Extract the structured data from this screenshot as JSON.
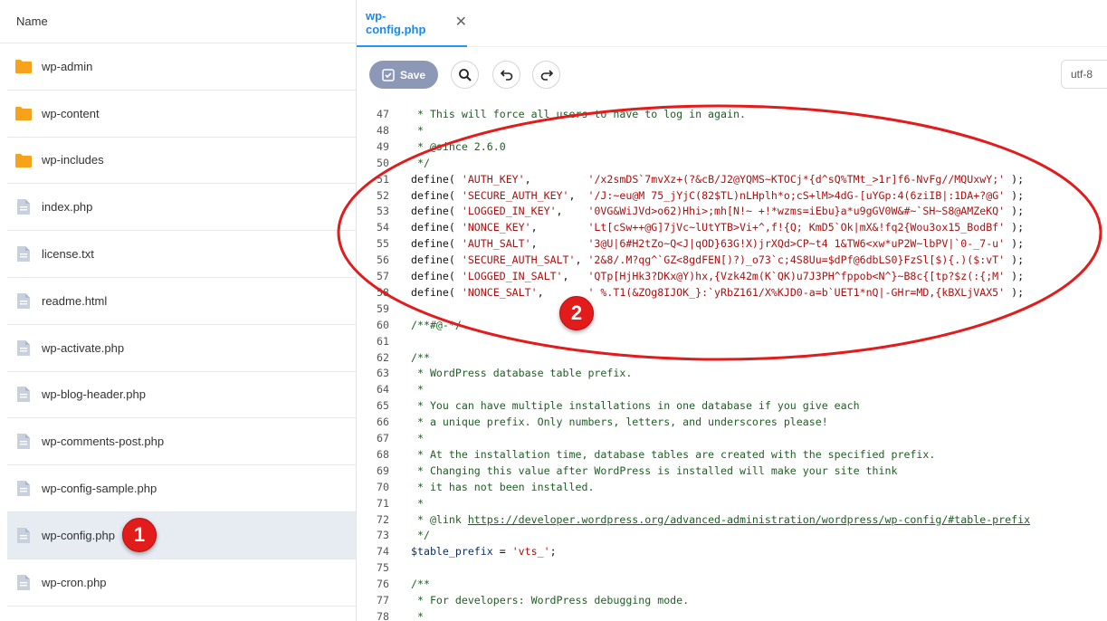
{
  "file_panel": {
    "header": "Name",
    "files": [
      {
        "name": "wp-admin",
        "type": "folder"
      },
      {
        "name": "wp-content",
        "type": "folder"
      },
      {
        "name": "wp-includes",
        "type": "folder"
      },
      {
        "name": "index.php",
        "type": "file"
      },
      {
        "name": "license.txt",
        "type": "file"
      },
      {
        "name": "readme.html",
        "type": "file"
      },
      {
        "name": "wp-activate.php",
        "type": "file"
      },
      {
        "name": "wp-blog-header.php",
        "type": "file"
      },
      {
        "name": "wp-comments-post.php",
        "type": "file"
      },
      {
        "name": "wp-config-sample.php",
        "type": "file"
      },
      {
        "name": "wp-config.php",
        "type": "file",
        "selected": true
      },
      {
        "name": "wp-cron.php",
        "type": "file"
      }
    ]
  },
  "editor": {
    "tab": {
      "label": "wp-config.php",
      "close_icon": "close-icon"
    },
    "toolbar": {
      "save_label": "Save",
      "search_icon": "search-icon",
      "undo_icon": "undo-icon",
      "redo_icon": "redo-icon",
      "encoding": "utf-8"
    },
    "code_lines": [
      {
        "n": "47",
        "t": " * This will force all users to have to log in again."
      },
      {
        "n": "48",
        "t": " *"
      },
      {
        "n": "49",
        "t": " * @since 2.6.0"
      },
      {
        "n": "50",
        "t": " */"
      },
      {
        "n": "51",
        "t": "define( 'AUTH_KEY',         '/x2smDS`7mvXz+(?&cB/J2@YQMS~KTOCj*{d^sQ%TMt_>1r]f6-NvFg//MQUxwY;' );"
      },
      {
        "n": "52",
        "t": "define( 'SECURE_AUTH_KEY',  '/J:~eu@M 75_jYjC(82$TL)nLHplh*o;cS+lM>4dG-[uYGp:4(6ziIB|:1DA+?@G' );"
      },
      {
        "n": "53",
        "t": "define( 'LOGGED_IN_KEY',    '0VG&WiJVd>o62)Hhi>;mh[N!~ +!*wzms=iEbu}a*u9gGV0W&#~`SH~S8@AMZeKQ' );"
      },
      {
        "n": "54",
        "t": "define( 'NONCE_KEY',        'Lt[cSw++@G]7jVc~lUtYTB>Vi+^,f!{Q; KmD5`Ok|mX&!fq2{Wou3ox15_BodBf' );"
      },
      {
        "n": "55",
        "t": "define( 'AUTH_SALT',        '3@U|6#H2tZo~Q<J|qOD}63G!X)jrXQd>CP~t4 1&TW6<xw*uP2W~lbPV|`0-_7-u' );"
      },
      {
        "n": "56",
        "t": "define( 'SECURE_AUTH_SALT', '2&8/.M?qg^`GZ<8gdFEN[)?)_o73`c;4S8Uu=$dPf@6dbLS0}FzSl[$){.)($:vT' );"
      },
      {
        "n": "57",
        "t": "define( 'LOGGED_IN_SALT',   'QTp[HjHk3?DKx@Y)hx,{Vzk42m(K`QK)u7J3PH^fppob<N^}~B8c{[tp?$z(:{;M' );"
      },
      {
        "n": "58",
        "t": "define( 'NONCE_SALT',       ' %.T1(&ZOg8IJOK_}:`yRbZ161/X%KJD0-a=b`UET1*nQ|-GHr=MD,{kBXLjVAX5' );"
      },
      {
        "n": "59",
        "t": ""
      },
      {
        "n": "60",
        "t": "/**#@-*/"
      },
      {
        "n": "61",
        "t": ""
      },
      {
        "n": "62",
        "t": "/**"
      },
      {
        "n": "63",
        "t": " * WordPress database table prefix."
      },
      {
        "n": "64",
        "t": " *"
      },
      {
        "n": "65",
        "t": " * You can have multiple installations in one database if you give each"
      },
      {
        "n": "66",
        "t": " * a unique prefix. Only numbers, letters, and underscores please!"
      },
      {
        "n": "67",
        "t": " *"
      },
      {
        "n": "68",
        "t": " * At the installation time, database tables are created with the specified prefix."
      },
      {
        "n": "69",
        "t": " * Changing this value after WordPress is installed will make your site think"
      },
      {
        "n": "70",
        "t": " * it has not been installed."
      },
      {
        "n": "71",
        "t": " *"
      },
      {
        "n": "72",
        "t": " * @link https://developer.wordpress.org/advanced-administration/wordpress/wp-config/#table-prefix"
      },
      {
        "n": "73",
        "t": " */"
      },
      {
        "n": "74",
        "t": "$table_prefix = 'vts_';"
      },
      {
        "n": "75",
        "t": ""
      },
      {
        "n": "76",
        "t": "/**"
      },
      {
        "n": "77",
        "t": " * For developers: WordPress debugging mode."
      },
      {
        "n": "78",
        "t": " *"
      }
    ]
  },
  "annotations": {
    "badge_1": "1",
    "badge_2": "2",
    "highlight_color": "#e21b1b"
  }
}
